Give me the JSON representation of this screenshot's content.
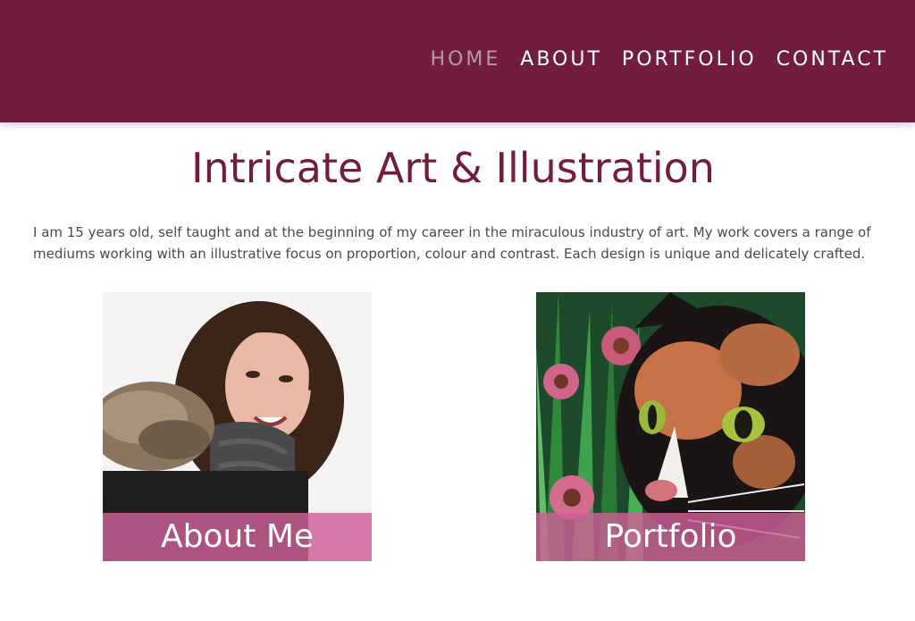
{
  "nav": {
    "items": [
      {
        "label": "HOME",
        "active": true
      },
      {
        "label": "ABOUT",
        "active": false
      },
      {
        "label": "PORTFOLIO",
        "active": false
      },
      {
        "label": "CONTACT",
        "active": false
      }
    ]
  },
  "main": {
    "title": "Intricate Art & Illustration",
    "intro": "I am 15 years old, self taught and at the beginning of my career in the miraculous industry of art. My work covers a range of mediums working with an illustrative focus on proportion, colour and contrast. Each design is unique and delicately crafted.",
    "cards": [
      {
        "label": "About Me",
        "image": "portrait-photo"
      },
      {
        "label": "Portfolio",
        "image": "cat-illustration"
      }
    ]
  },
  "colors": {
    "brand": "#721c3e",
    "nav_active": "#b39aa5",
    "label_overlay": "#cd5f96",
    "body_text": "#4a4a4a"
  }
}
